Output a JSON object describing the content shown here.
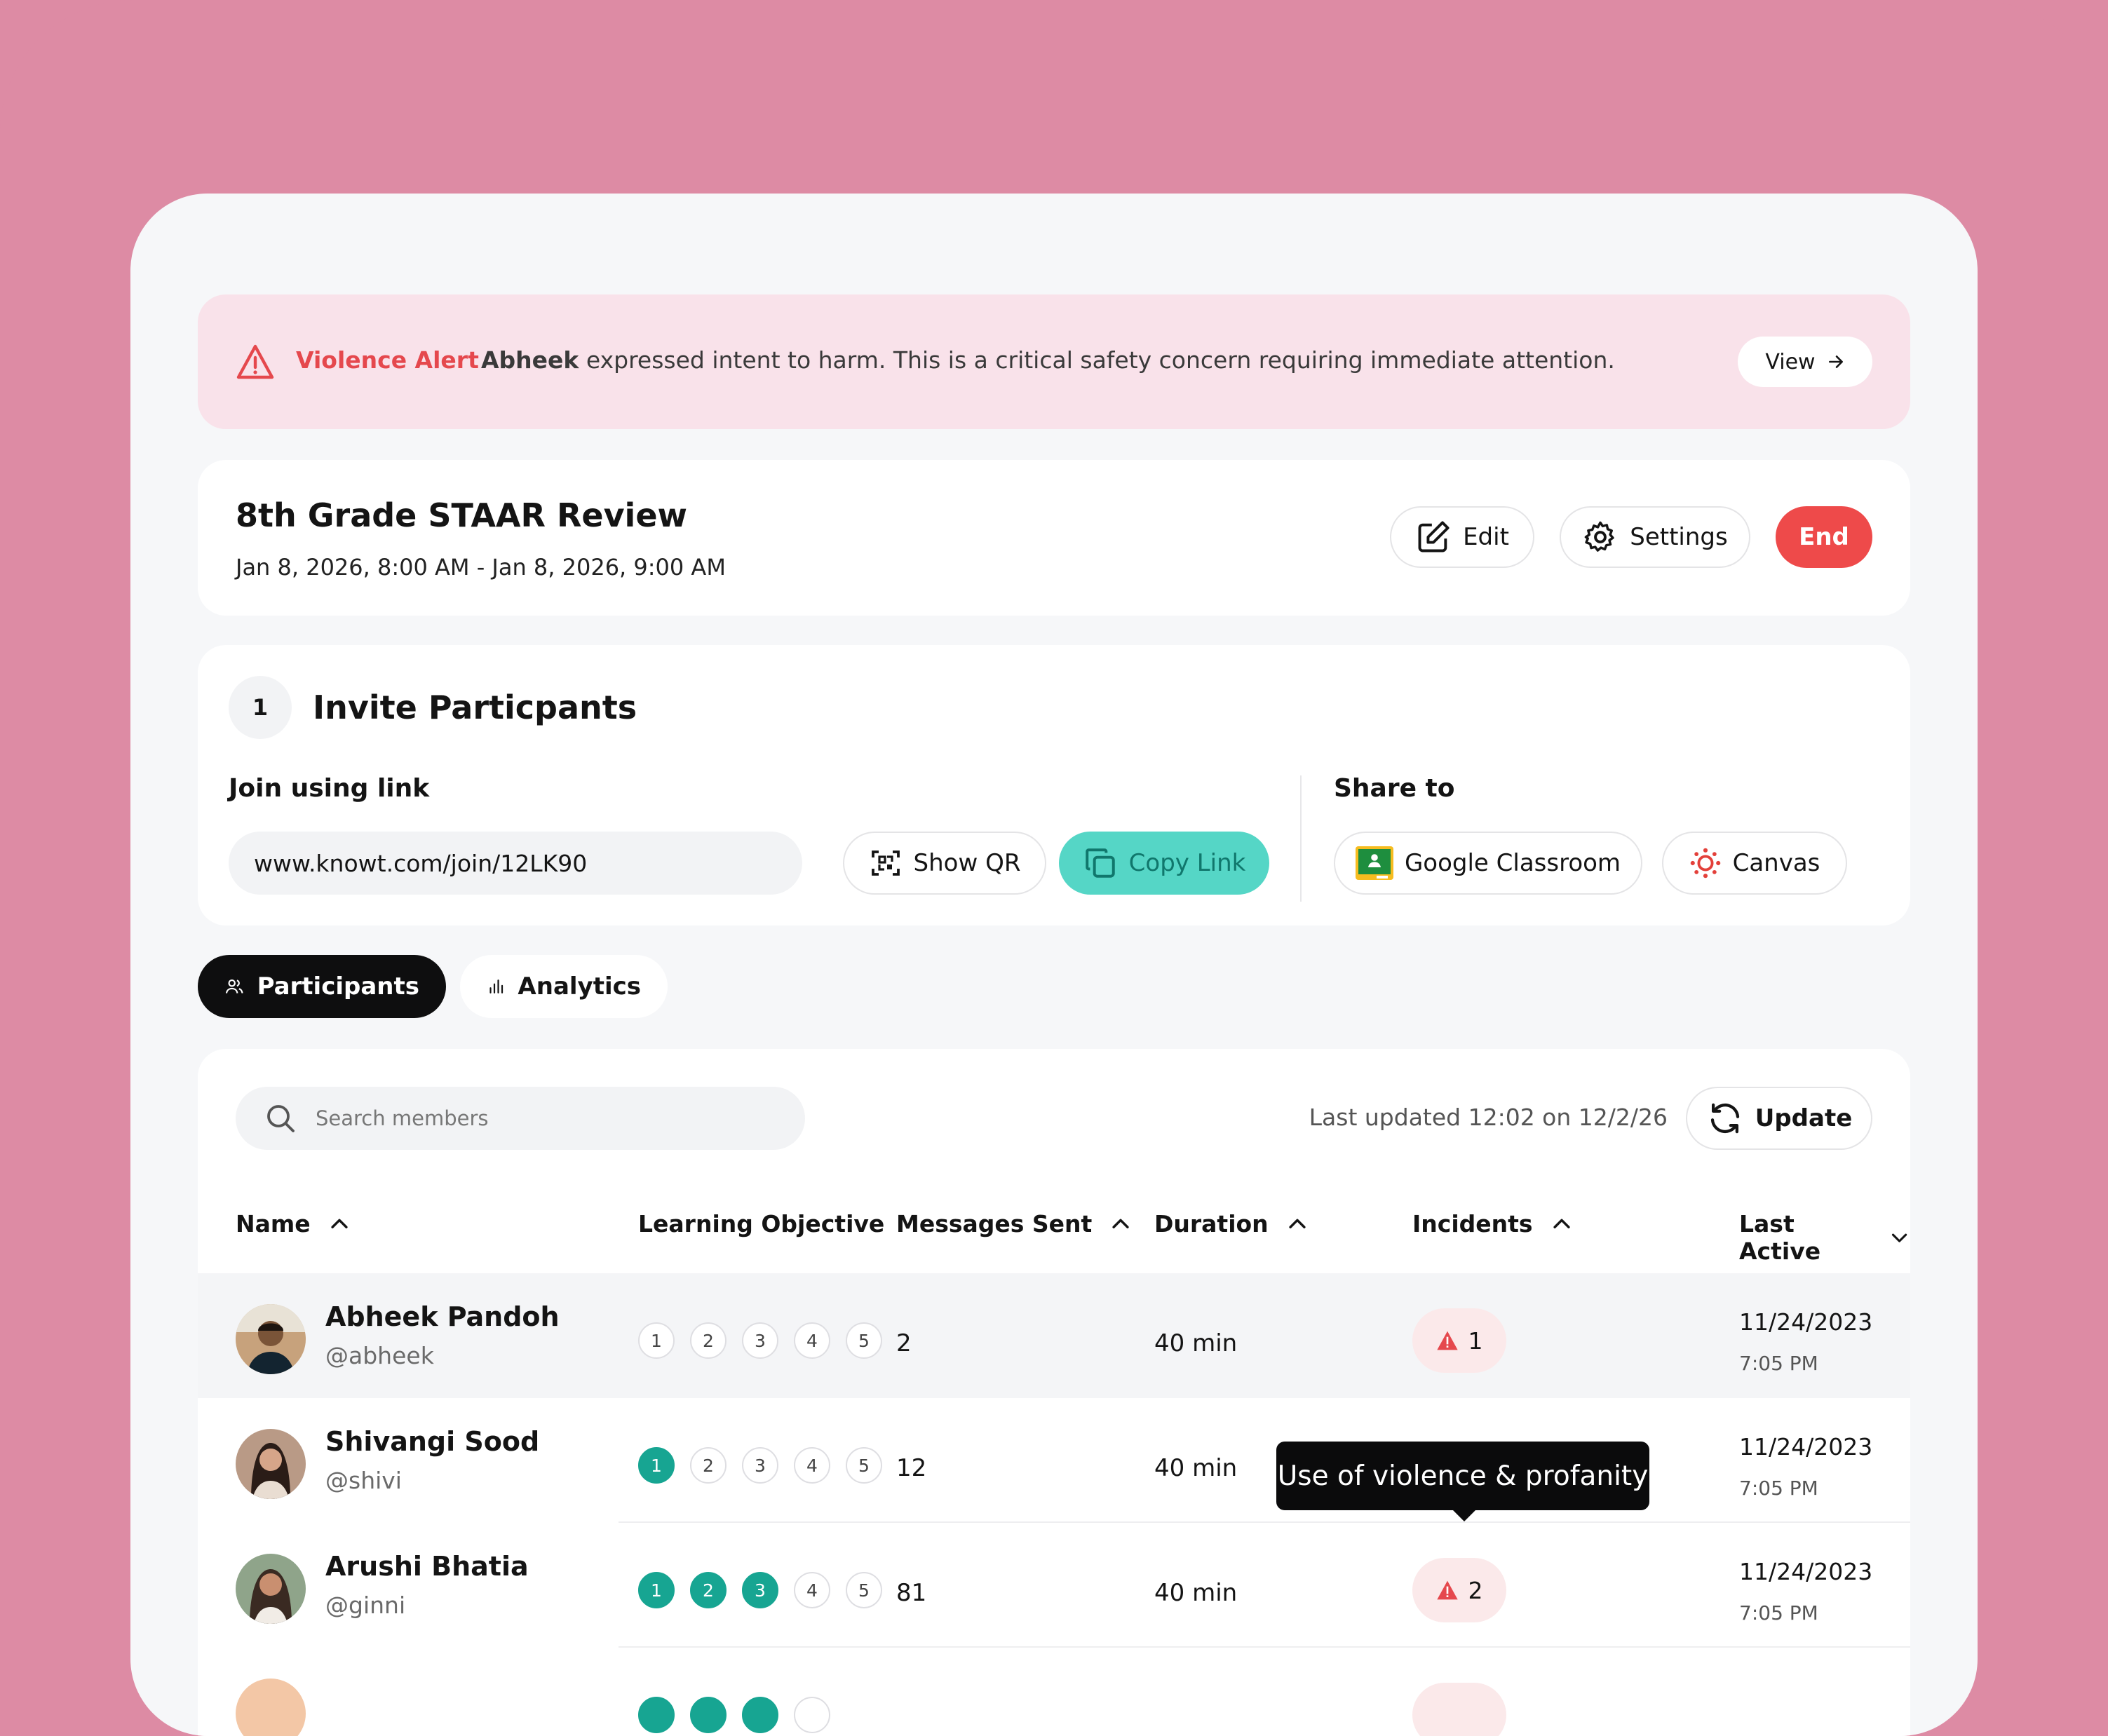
{
  "alert": {
    "type": "Violence Alert",
    "student": "Abheek",
    "message": " expressed  intent to harm. This is a critical safety concern requiring immediate attention.",
    "view_label": "View"
  },
  "session": {
    "title": "8th Grade STAAR Review",
    "date_range": "Jan 8, 2026, 8:00 AM - Jan 8, 2026, 9:00 AM",
    "edit_label": "Edit",
    "settings_label": "Settings",
    "end_label": "End"
  },
  "invite": {
    "step": "1",
    "title": "Invite Particpants",
    "join_label": "Join using link",
    "link": "www.knowt.com/join/12LK90",
    "show_qr_label": "Show QR",
    "copy_link_label": "Copy Link",
    "share_label": "Share to",
    "google_label": "Google Classroom",
    "canvas_label": "Canvas"
  },
  "tabs": [
    {
      "label": "Participants",
      "active": true
    },
    {
      "label": "Analytics",
      "active": false
    }
  ],
  "table": {
    "search_placeholder": "Search members",
    "last_updated": "Last updated 12:02 on 12/2/26",
    "update_label": "Update",
    "columns": [
      "Name",
      "Learning Objective",
      "Messages Sent",
      "Duration",
      "Incidents",
      "Last Active"
    ],
    "rows": [
      {
        "name": "Abheek Pandoh",
        "handle": "@abheek",
        "objectives_done": 0,
        "messages": "2",
        "duration": "40 min",
        "incidents": "1",
        "date": "11/24/2023",
        "time": "7:05 PM"
      },
      {
        "name": "Shivangi Sood",
        "handle": "@shivi",
        "objectives_done": 1,
        "messages": "12",
        "duration": "40 min",
        "incidents": "",
        "date": "11/24/2023",
        "time": "7:05 PM"
      },
      {
        "name": "Arushi Bhatia",
        "handle": "@ginni",
        "objectives_done": 3,
        "messages": "81",
        "duration": "40 min",
        "incidents": "2",
        "date": "11/24/2023",
        "time": "7:05 PM"
      }
    ],
    "tooltip": "Use of violence & profanity"
  },
  "colors": {
    "accent": "#55d6c6",
    "success": "#17a592",
    "danger": "#ee4a4a",
    "alert_bg": "#f9e2ea"
  }
}
